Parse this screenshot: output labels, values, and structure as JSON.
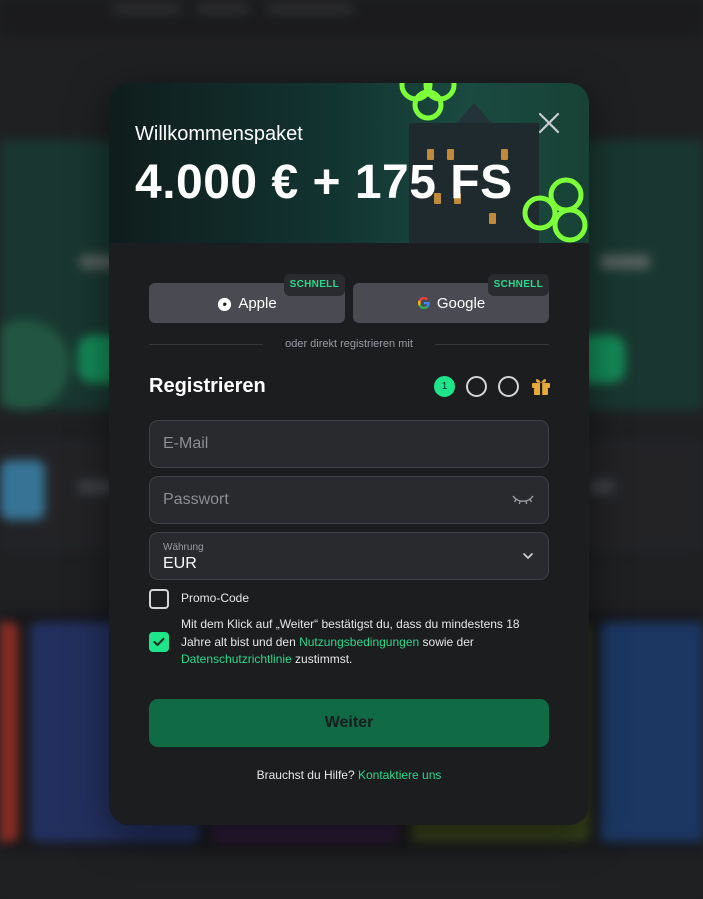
{
  "modal": {
    "hero_subtitle": "Willkommenspaket",
    "hero_title": "4.000 € + 175 FS",
    "social": {
      "apple_label": "Apple",
      "google_label": "Google",
      "badge": "SCHNELL"
    },
    "divider_text": "oder direkt registrieren mit",
    "register_title": "Registrieren",
    "steps": {
      "current": "1",
      "total": 3
    },
    "fields": {
      "email_placeholder": "E-Mail",
      "password_placeholder": "Passwort",
      "currency_label": "Währung",
      "currency_value": "EUR"
    },
    "promo_label": "Promo-Code",
    "terms": {
      "part1": "Mit dem Klick auf „Weiter“ bestätigst du, dass du mindestens 18 Jahre alt bist und den ",
      "link1": "Nutzungsbedingungen",
      "part2": " sowie der ",
      "link2": "Datenschutzrichtlinie",
      "part3": " zustimmst."
    },
    "submit_label": "Weiter",
    "help_text": "Brauchst du Hilfe?",
    "help_link": "Kontaktiere uns"
  },
  "colors": {
    "accent": "#1fe58a",
    "submit_bg": "#0f6a45",
    "link": "#2bd98c",
    "modal_bg": "#1c1d1f"
  },
  "icons": [
    "close-icon",
    "apple-icon",
    "google-icon",
    "eye-closed-icon",
    "chevron-down-icon",
    "gift-icon",
    "check-icon"
  ]
}
